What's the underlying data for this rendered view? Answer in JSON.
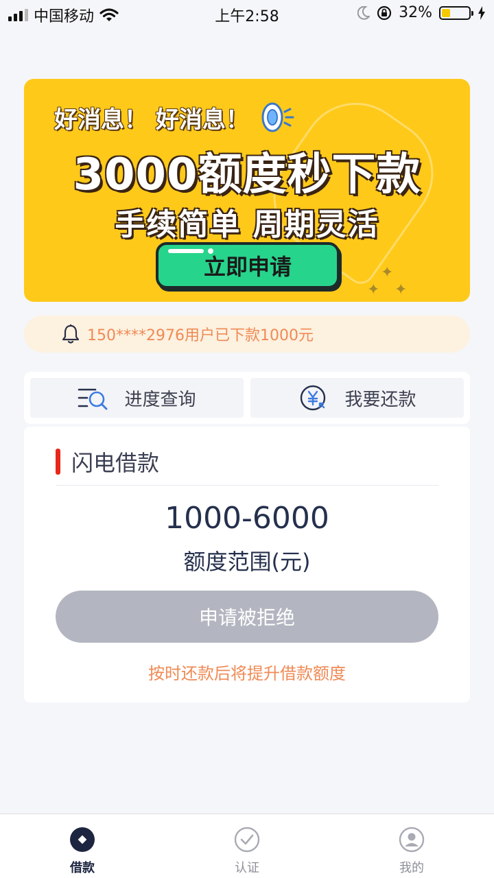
{
  "status_bar": {
    "carrier": "中国移动",
    "time": "上午2:58",
    "battery": "32%",
    "battery_level": 0.32
  },
  "banner": {
    "top_line": "好消息！ 好消息！",
    "headline": "3000额度秒下款",
    "subline": "手续简单 周期灵活",
    "cta": "立即申请",
    "colors": {
      "background": "#ffc919",
      "cta": "#27d48c"
    }
  },
  "notice": {
    "icon": "bell-icon",
    "text": "150****2976用户已下款1000元"
  },
  "quick_actions": [
    {
      "label": "进度查询",
      "icon": "progress-search-icon"
    },
    {
      "label": "我要还款",
      "icon": "repay-yen-icon"
    }
  ],
  "loan_card": {
    "title": "闪电借款",
    "amount_range": "1000-6000",
    "amount_label": "额度范围(元)",
    "button_label": "申请被拒绝",
    "hint": "按时还款后将提升借款额度",
    "accent": "#e8271b"
  },
  "tabbar": {
    "items": [
      {
        "label": "借款",
        "icon": "loan-icon",
        "active": true
      },
      {
        "label": "认证",
        "icon": "check-circle-icon",
        "active": false
      },
      {
        "label": "我的",
        "icon": "user-icon",
        "active": false
      }
    ]
  }
}
